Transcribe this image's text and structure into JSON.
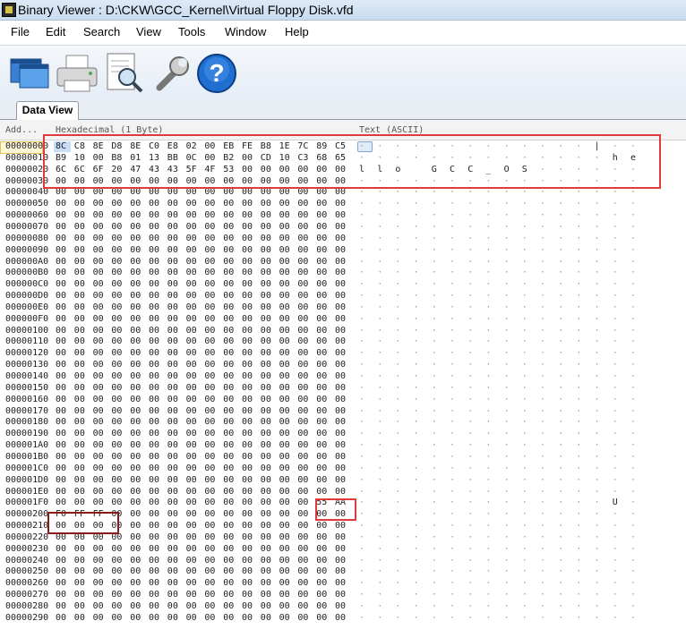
{
  "window": {
    "title": "Binary Viewer : D:\\CKW\\GCC_Kernel\\Virtual Floppy Disk.vfd"
  },
  "menu": [
    "File",
    "Edit",
    "Search",
    "View",
    "Tools",
    "Window",
    "Help"
  ],
  "toolbar": {
    "icons": [
      "windows-icon",
      "printer-icon",
      "print-preview-icon",
      "wrench-icon",
      "help-icon"
    ]
  },
  "tabs": [
    "Data View"
  ],
  "columns": {
    "address": "Add...",
    "hex": "Hexadecimal (1 Byte)",
    "text": "Text (ASCII)"
  },
  "rows": [
    {
      "addr": "00000000",
      "hex": "8C C8 8E D8 8E C0 E8 02 00 EB FE B8 1E 7C 89 C5",
      "text": [
        "",
        "",
        "",
        "",
        "",
        "",
        "",
        "",
        "",
        "",
        "",
        "",
        "",
        "|",
        "",
        ""
      ]
    },
    {
      "addr": "00000010",
      "hex": "B9 10 00 B8 01 13 BB 0C 00 B2 00 CD 10 C3 68 65",
      "text": [
        "",
        "",
        "",
        "",
        "",
        "",
        "",
        "",
        "",
        "",
        "",
        "",
        "",
        "",
        "h",
        "e"
      ]
    },
    {
      "addr": "00000020",
      "hex": "6C 6C 6F 20 47 43 43 5F 4F 53 00 00 00 00 00 00",
      "text": [
        "l",
        "l",
        "o",
        " ",
        "G",
        "C",
        "C",
        "_",
        "O",
        "S",
        "",
        "",
        "",
        "",
        "",
        ""
      ]
    },
    {
      "addr": "00000030",
      "hex": "00 00 00 00 00 00 00 00 00 00 00 00 00 00 00 00",
      "text": []
    },
    {
      "addr": "00000040",
      "hex": "00 00 00 00 00 00 00 00 00 00 00 00 00 00 00 00",
      "text": []
    },
    {
      "addr": "00000050",
      "hex": "00 00 00 00 00 00 00 00 00 00 00 00 00 00 00 00",
      "text": []
    },
    {
      "addr": "00000060",
      "hex": "00 00 00 00 00 00 00 00 00 00 00 00 00 00 00 00",
      "text": []
    },
    {
      "addr": "00000070",
      "hex": "00 00 00 00 00 00 00 00 00 00 00 00 00 00 00 00",
      "text": []
    },
    {
      "addr": "00000080",
      "hex": "00 00 00 00 00 00 00 00 00 00 00 00 00 00 00 00",
      "text": []
    },
    {
      "addr": "00000090",
      "hex": "00 00 00 00 00 00 00 00 00 00 00 00 00 00 00 00",
      "text": []
    },
    {
      "addr": "000000A0",
      "hex": "00 00 00 00 00 00 00 00 00 00 00 00 00 00 00 00",
      "text": []
    },
    {
      "addr": "000000B0",
      "hex": "00 00 00 00 00 00 00 00 00 00 00 00 00 00 00 00",
      "text": []
    },
    {
      "addr": "000000C0",
      "hex": "00 00 00 00 00 00 00 00 00 00 00 00 00 00 00 00",
      "text": []
    },
    {
      "addr": "000000D0",
      "hex": "00 00 00 00 00 00 00 00 00 00 00 00 00 00 00 00",
      "text": []
    },
    {
      "addr": "000000E0",
      "hex": "00 00 00 00 00 00 00 00 00 00 00 00 00 00 00 00",
      "text": []
    },
    {
      "addr": "000000F0",
      "hex": "00 00 00 00 00 00 00 00 00 00 00 00 00 00 00 00",
      "text": []
    },
    {
      "addr": "00000100",
      "hex": "00 00 00 00 00 00 00 00 00 00 00 00 00 00 00 00",
      "text": []
    },
    {
      "addr": "00000110",
      "hex": "00 00 00 00 00 00 00 00 00 00 00 00 00 00 00 00",
      "text": []
    },
    {
      "addr": "00000120",
      "hex": "00 00 00 00 00 00 00 00 00 00 00 00 00 00 00 00",
      "text": []
    },
    {
      "addr": "00000130",
      "hex": "00 00 00 00 00 00 00 00 00 00 00 00 00 00 00 00",
      "text": []
    },
    {
      "addr": "00000140",
      "hex": "00 00 00 00 00 00 00 00 00 00 00 00 00 00 00 00",
      "text": []
    },
    {
      "addr": "00000150",
      "hex": "00 00 00 00 00 00 00 00 00 00 00 00 00 00 00 00",
      "text": []
    },
    {
      "addr": "00000160",
      "hex": "00 00 00 00 00 00 00 00 00 00 00 00 00 00 00 00",
      "text": []
    },
    {
      "addr": "00000170",
      "hex": "00 00 00 00 00 00 00 00 00 00 00 00 00 00 00 00",
      "text": []
    },
    {
      "addr": "00000180",
      "hex": "00 00 00 00 00 00 00 00 00 00 00 00 00 00 00 00",
      "text": []
    },
    {
      "addr": "00000190",
      "hex": "00 00 00 00 00 00 00 00 00 00 00 00 00 00 00 00",
      "text": []
    },
    {
      "addr": "000001A0",
      "hex": "00 00 00 00 00 00 00 00 00 00 00 00 00 00 00 00",
      "text": []
    },
    {
      "addr": "000001B0",
      "hex": "00 00 00 00 00 00 00 00 00 00 00 00 00 00 00 00",
      "text": []
    },
    {
      "addr": "000001C0",
      "hex": "00 00 00 00 00 00 00 00 00 00 00 00 00 00 00 00",
      "text": []
    },
    {
      "addr": "000001D0",
      "hex": "00 00 00 00 00 00 00 00 00 00 00 00 00 00 00 00",
      "text": []
    },
    {
      "addr": "000001E0",
      "hex": "00 00 00 00 00 00 00 00 00 00 00 00 00 00 00 00",
      "text": []
    },
    {
      "addr": "000001F0",
      "hex": "00 00 00 00 00 00 00 00 00 00 00 00 00 00 55 AA",
      "text": [
        "",
        "",
        "",
        "",
        "",
        "",
        "",
        "",
        "",
        "",
        "",
        "",
        "",
        "",
        "U",
        ""
      ]
    },
    {
      "addr": "00000200",
      "hex": "F0 FF FF 00 00 00 00 00 00 00 00 00 00 00 00 00",
      "text": []
    },
    {
      "addr": "00000210",
      "hex": "00 00 00 00 00 00 00 00 00 00 00 00 00 00 00 00",
      "text": []
    },
    {
      "addr": "00000220",
      "hex": "00 00 00 00 00 00 00 00 00 00 00 00 00 00 00 00",
      "text": []
    },
    {
      "addr": "00000230",
      "hex": "00 00 00 00 00 00 00 00 00 00 00 00 00 00 00 00",
      "text": []
    },
    {
      "addr": "00000240",
      "hex": "00 00 00 00 00 00 00 00 00 00 00 00 00 00 00 00",
      "text": []
    },
    {
      "addr": "00000250",
      "hex": "00 00 00 00 00 00 00 00 00 00 00 00 00 00 00 00",
      "text": []
    },
    {
      "addr": "00000260",
      "hex": "00 00 00 00 00 00 00 00 00 00 00 00 00 00 00 00",
      "text": []
    },
    {
      "addr": "00000270",
      "hex": "00 00 00 00 00 00 00 00 00 00 00 00 00 00 00 00",
      "text": []
    },
    {
      "addr": "00000280",
      "hex": "00 00 00 00 00 00 00 00 00 00 00 00 00 00 00 00",
      "text": []
    },
    {
      "addr": "00000290",
      "hex": "00 00 00 00 00 00 00 00 00 00 00 00 00 00 00 00",
      "text": []
    }
  ],
  "colors": {
    "annotation_red": "#e03a3a",
    "annotation_dark_red": "#8b1a1a",
    "selection_blue": "#c9ddf6"
  }
}
